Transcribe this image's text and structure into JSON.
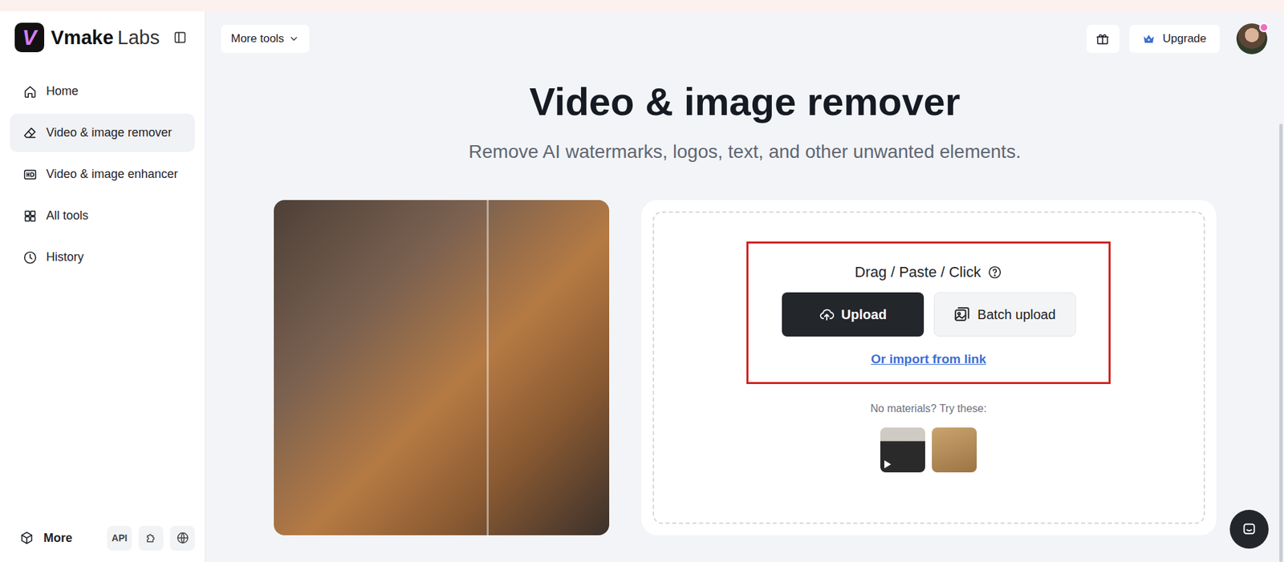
{
  "logo": {
    "mark": "V",
    "name": "Vmake",
    "suffix": "Labs"
  },
  "sidebar": {
    "items": [
      {
        "label": "Home",
        "selected": false
      },
      {
        "label": "Video & image remover",
        "selected": true
      },
      {
        "label": "Video & image enhancer",
        "selected": false
      },
      {
        "label": "All tools",
        "selected": false
      },
      {
        "label": "History",
        "selected": false
      }
    ],
    "footer": {
      "more": "More",
      "api": "API"
    }
  },
  "header": {
    "more_tools": "More tools",
    "upgrade": "Upgrade"
  },
  "hero": {
    "title": "Video & image remover",
    "subtitle": "Remove AI watermarks, logos, text, and other unwanted elements."
  },
  "upload": {
    "hint": "Drag / Paste / Click",
    "upload": "Upload",
    "batch": "Batch upload",
    "link": "Or import from link",
    "samples_label": "No materials? Try these:",
    "samples": [
      {
        "kind": "video"
      },
      {
        "kind": "image"
      }
    ]
  }
}
